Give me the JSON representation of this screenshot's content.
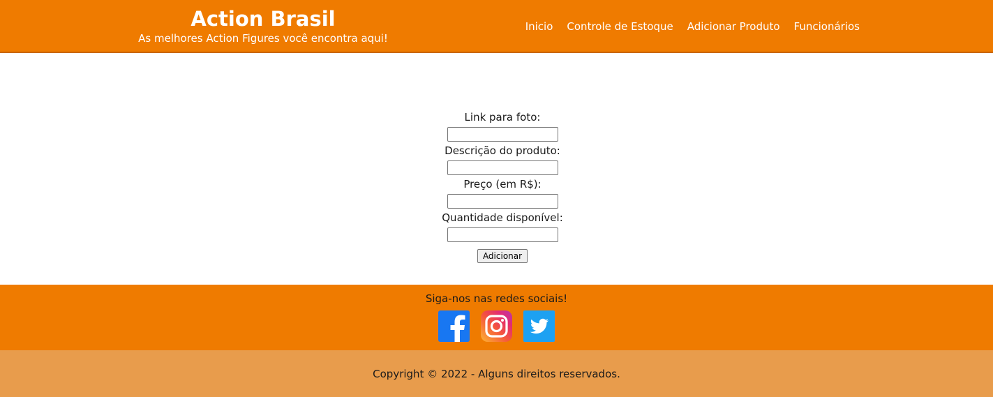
{
  "header": {
    "title": "Action Brasil",
    "subtitle": "As melhores Action Figures você encontra aqui!",
    "nav": [
      "Inicio",
      "Controle de Estoque",
      "Adicionar Produto",
      "Funcionários"
    ]
  },
  "form": {
    "fields": [
      {
        "label": "Link para foto:",
        "value": ""
      },
      {
        "label": "Descrição do produto:",
        "value": ""
      },
      {
        "label": "Preço (em R$):",
        "value": ""
      },
      {
        "label": "Quantidade disponível:",
        "value": ""
      }
    ],
    "submit_label": "Adicionar"
  },
  "social": {
    "label": "Siga-nos nas redes sociais!",
    "icons": [
      "facebook-icon",
      "instagram-icon",
      "twitter-icon"
    ]
  },
  "footer": {
    "copyright": "Copyright © 2022 - Alguns direitos reservados."
  },
  "colors": {
    "header": "#ef7b00",
    "social_band": "#ef7b00",
    "footer": "#e89c4c",
    "facebook": "#1877f2",
    "twitter": "#1da1f2"
  }
}
